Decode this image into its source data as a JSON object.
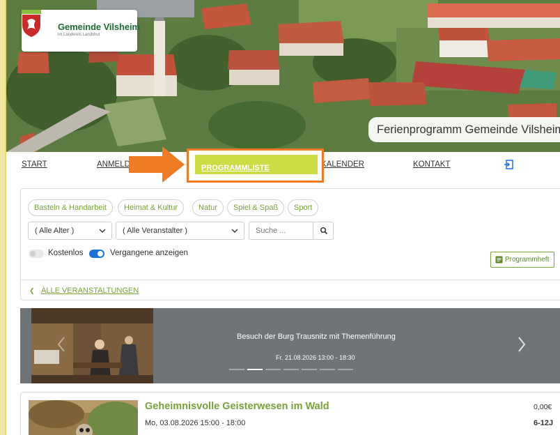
{
  "header": {
    "logo_name": "Gemeinde Vilsheim",
    "logo_sub": "im Landkreis Landshut",
    "caption": "Ferienprogramm Gemeinde Vilsheim"
  },
  "nav": {
    "items": [
      {
        "label": "START"
      },
      {
        "label": "ANMELDE"
      },
      {
        "label": "PROGRAMMLISTE",
        "active": true
      },
      {
        "label": "KALENDER"
      },
      {
        "label": "KONTAKT"
      }
    ],
    "login_icon": "login-icon",
    "highlight_color": "#ef7b25",
    "active_color": "#cddb45"
  },
  "filters": {
    "categories": [
      "Basteln & Handarbeit",
      "Heimat & Kultur",
      "Natur",
      "Spiel & Spaß",
      "Sport"
    ],
    "age_select": "( Alle Alter )",
    "organizer_select": "( Alle Veranstalter )",
    "search_placeholder": "Suche ...",
    "toggle_free_label": "Kostenlos",
    "toggle_past_label": "Vergangene anzeigen",
    "programmheft_label": "Programmheft",
    "all_events_label": "ALLE VERANSTALTUNGEN",
    "accent_color": "#7aa13a"
  },
  "slider": {
    "title": "Besuch der Burg Trausnitz mit Themenführung",
    "date": "Fr. 21.08.2026 13:00 - 18:30",
    "slide_count": 7,
    "active_index": 1
  },
  "event": {
    "title": "Geheimnisvolle Geisterwesen im Wald",
    "date": "Mo, 03.08.2026 15:00 - 18:00",
    "price": "0,00€",
    "age": "6-12J"
  }
}
